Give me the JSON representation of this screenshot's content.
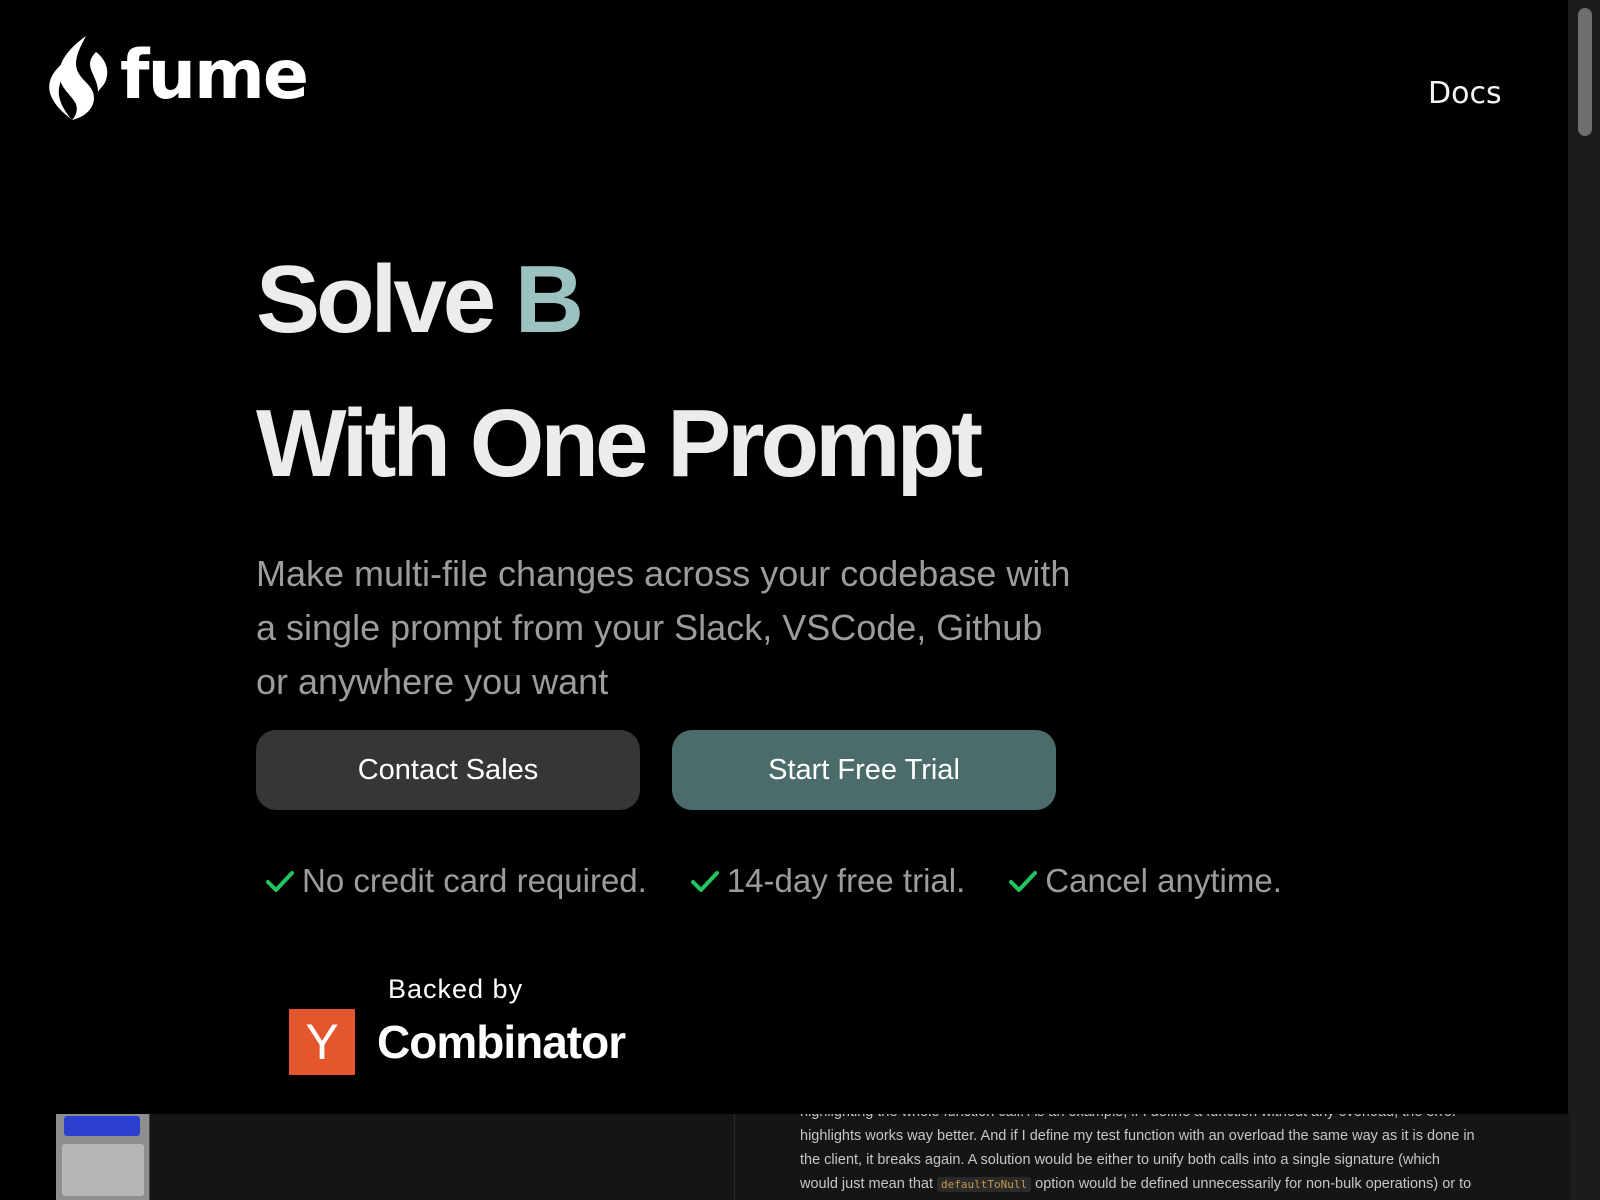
{
  "header": {
    "logo_text": "fume",
    "docs_label": "Docs"
  },
  "hero": {
    "headline_line1_prefix": "Solve ",
    "headline_line1_accent": "B",
    "headline_line2": "With One Prompt",
    "subtitle": "Make multi-file changes across your codebase with a single prompt from your Slack, VSCode, Github or anywhere you want",
    "contact_sales_label": "Contact Sales",
    "start_trial_label": "Start Free Trial",
    "features": [
      "No credit card required.",
      "14-day free trial.",
      "Cancel anytime."
    ]
  },
  "backed": {
    "label": "Backed by",
    "yc_letter": "Y",
    "yc_name": "Combinator"
  },
  "demo": {
    "lines": [
      "highlighting the whole function call. As an example, if I define a function without any overload, the error",
      "highlights works way better. And if I define my test function with an overload the same way as it is done in",
      "the client, it breaks again. A solution would be either to unify both calls into a single signature (which"
    ],
    "line4_before": "would just mean that ",
    "line4_code": "defaultToNull",
    "line4_after": " option would be defined unnecessarily for non-bulk operations) or to"
  },
  "colors": {
    "background": "#000000",
    "accent_text": "#9cc1c1",
    "trial_button": "#4b6c6b",
    "sales_button": "#363636",
    "check": "#22c55e",
    "yc_orange": "#e4572e"
  },
  "icons": {
    "logo": "flame-icon",
    "feature": "check-icon"
  }
}
